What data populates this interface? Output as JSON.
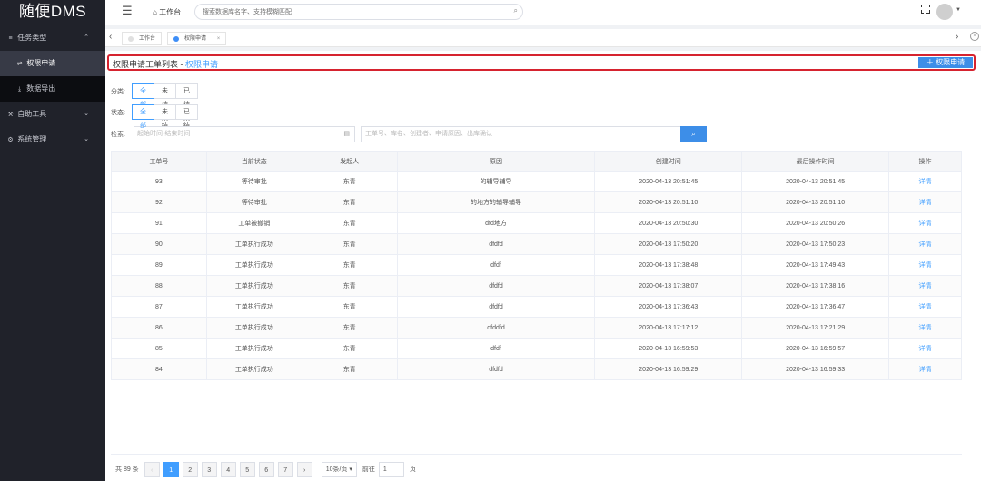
{
  "app": {
    "logo": "随便DMS"
  },
  "sidebar": {
    "groups": [
      {
        "icon": "≡",
        "label": "任务类型",
        "arrow": "⌃"
      },
      {
        "icon": "⚒",
        "label": "自助工具",
        "arrow": "⌄"
      },
      {
        "icon": "⚙",
        "label": "系统管理",
        "arrow": "⌄"
      }
    ],
    "sub_items": [
      {
        "icon": "⇌",
        "label": "权限申请"
      },
      {
        "icon": "⤓",
        "label": "数据导出"
      }
    ]
  },
  "header": {
    "home_label": "工作台",
    "search_placeholder": "搜索数据库名字、支持模糊匹配"
  },
  "tabs": {
    "items": [
      {
        "label": "工作台"
      },
      {
        "label": "权限申请",
        "close": "×"
      }
    ]
  },
  "page": {
    "title": "权限申请工单列表 - ",
    "title_sub": "权限申请",
    "add_button": "＋  权限申请"
  },
  "filters": {
    "category_label": "分类:",
    "category_options": [
      "全部",
      "未结束",
      "已结束"
    ],
    "status_label": "状态:",
    "status_options": [
      "全部",
      "未结束",
      "已结束"
    ],
    "search_label": "检索:",
    "date_placeholder": "起始时间-结束时间",
    "keyword_placeholder": "工单号、库名、创建者、申请原因、出库确认"
  },
  "table": {
    "columns": [
      "工单号",
      "当前状态",
      "发起人",
      "原因",
      "创建时间",
      "最后操作时间",
      "操作"
    ],
    "rows": [
      [
        "93",
        "等待审批",
        "东青",
        "的辅导辅导",
        "2020-04-13 20:51:45",
        "2020-04-13 20:51:45",
        "详情"
      ],
      [
        "92",
        "等待审批",
        "东青",
        "的地方的辅导辅导",
        "2020-04-13 20:51:10",
        "2020-04-13 20:51:10",
        "详情"
      ],
      [
        "91",
        "工单被撤销",
        "东青",
        "dfd地方",
        "2020-04-13 20:50:30",
        "2020-04-13 20:50:26",
        "详情"
      ],
      [
        "90",
        "工单执行成功",
        "东青",
        "dfdfd",
        "2020-04-13 17:50:20",
        "2020-04-13 17:50:23",
        "详情"
      ],
      [
        "89",
        "工单执行成功",
        "东青",
        "dfdf",
        "2020-04-13 17:38:48",
        "2020-04-13 17:49:43",
        "详情"
      ],
      [
        "88",
        "工单执行成功",
        "东青",
        "dfdfd",
        "2020-04-13 17:38:07",
        "2020-04-13 17:38:16",
        "详情"
      ],
      [
        "87",
        "工单执行成功",
        "东青",
        "dfdfd",
        "2020-04-13 17:36:43",
        "2020-04-13 17:36:47",
        "详情"
      ],
      [
        "86",
        "工单执行成功",
        "东青",
        "dfddfd",
        "2020-04-13 17:17:12",
        "2020-04-13 17:21:29",
        "详情"
      ],
      [
        "85",
        "工单执行成功",
        "东青",
        "dfdf",
        "2020-04-13 16:59:53",
        "2020-04-13 16:59:57",
        "详情"
      ],
      [
        "84",
        "工单执行成功",
        "东青",
        "dfdfd",
        "2020-04-13 16:59:29",
        "2020-04-13 16:59:33",
        "详情"
      ]
    ]
  },
  "pagination": {
    "total": "共 89 条",
    "prev": "‹",
    "next": "›",
    "pages": [
      "1",
      "2",
      "3",
      "4",
      "5",
      "6",
      "7"
    ],
    "current": "1",
    "page_size": "10条/页 ▾",
    "goto_label": "前往",
    "goto_value": "1",
    "page_unit": "页"
  },
  "colors": {
    "accent": "#409eff",
    "highlight_border": "#d6232f",
    "sidebar_bg": "#20222a"
  }
}
